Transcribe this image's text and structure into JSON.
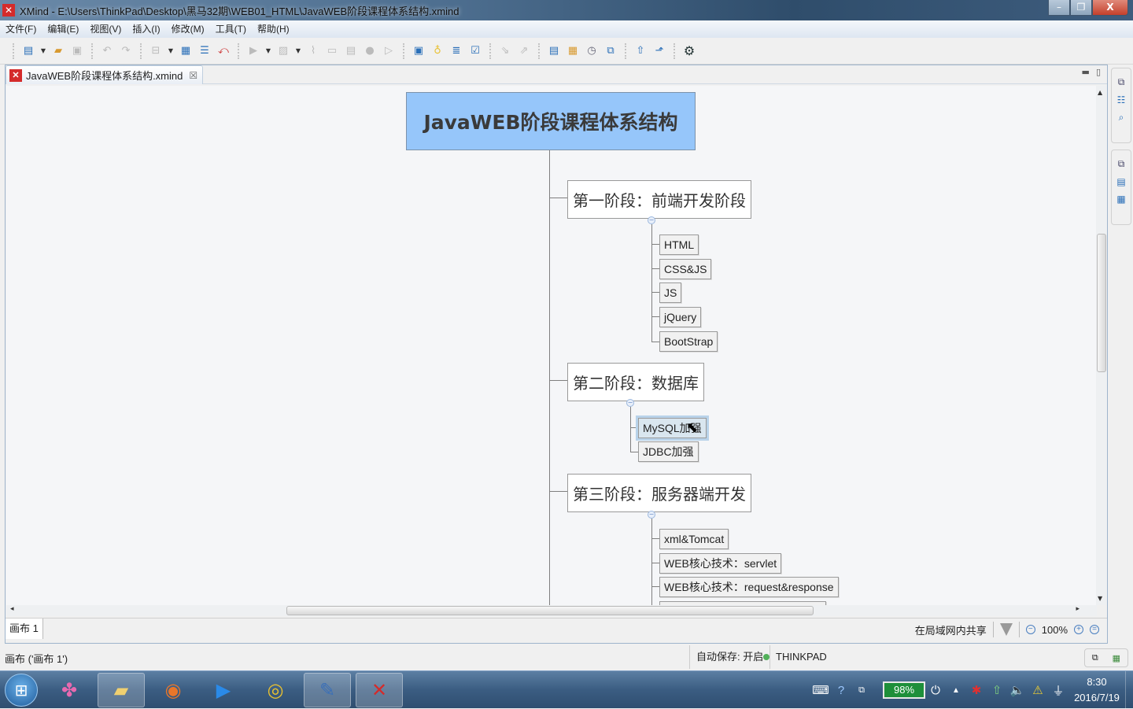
{
  "window": {
    "title": "XMind - E:\\Users\\ThinkPad\\Desktop\\黑马32期\\WEB01_HTML\\JavaWEB阶段课程体系结构.xmind",
    "app_icon": "xmind-icon",
    "controls": {
      "minimize": "–",
      "maximize": "❐",
      "close": "X"
    }
  },
  "menubar": {
    "items": [
      "文件(F)",
      "编辑(E)",
      "视图(V)",
      "插入(I)",
      "修改(M)",
      "工具(T)",
      "帮助(H)"
    ]
  },
  "toolbar": {
    "groups": [
      [
        "new-workbook-icon",
        "dropdown-icon",
        "open-folder-icon",
        "save-icon"
      ],
      [
        "undo-icon",
        "redo-icon"
      ],
      [
        "insert-topic-icon",
        "dropdown-icon",
        "boundary-icon",
        "summary-icon",
        "relationship-icon"
      ],
      [
        "marker-flag-icon",
        "dropdown-icon",
        "image-icon",
        "dropdown-icon",
        "attachment-icon",
        "split-icon",
        "note-icon",
        "hyperlink-icon",
        "audio-icon"
      ],
      [
        "presentation-icon",
        "brainstorm-icon",
        "gantt-icon",
        "task-icon"
      ],
      [
        "drill-down-icon",
        "drill-up-icon"
      ],
      [
        "outline-view-icon",
        "spreadsheet-icon",
        "timeline-icon",
        "zoom-view-icon"
      ],
      [
        "upload-icon",
        "export-icon"
      ],
      [
        "settings-gear-icon"
      ]
    ]
  },
  "editor": {
    "tab_label": "JavaWEB阶段课程体系结构.xmind",
    "tab_close": "☒",
    "sheet_tab": "画布 1",
    "share_label": "在局域网内共享",
    "zoom_level": "100%",
    "zoom_out": "−",
    "zoom_in": "+",
    "zoom_fit": "="
  },
  "mindmap": {
    "central": "JavaWEB阶段课程体系结构",
    "branches": [
      {
        "label": "第一阶段：前端开发阶段",
        "children": [
          "HTML",
          "CSS&JS",
          "JS",
          "jQuery",
          "BootStrap"
        ]
      },
      {
        "label": "第二阶段：数据库",
        "children": [
          "MySQL加强",
          "JDBC加强"
        ],
        "selected_child": "MySQL加强"
      },
      {
        "label": "第三阶段：服务器端开发",
        "children": [
          "xml&Tomcat",
          "WEB核心技术：servlet",
          "WEB核心技术：request&response"
        ]
      }
    ]
  },
  "statusbar": {
    "selection": "画布 ('画布 1')",
    "autosave": "自动保存: 开启",
    "user": "THINKPAD",
    "user_status_color": "#52b05a"
  },
  "taskbar": {
    "apps": [
      "start-orb",
      "app-clover",
      "file-explorer",
      "firefox",
      "video-player",
      "chrome",
      "editor-app",
      "xmind"
    ],
    "tray": {
      "battery": "98%",
      "time": "8:30",
      "date": "2016/7/19"
    }
  },
  "colors": {
    "central_fill": "#96c6fa",
    "xmind_red": "#d42b2b",
    "battery_green": "#1e8f3a"
  }
}
